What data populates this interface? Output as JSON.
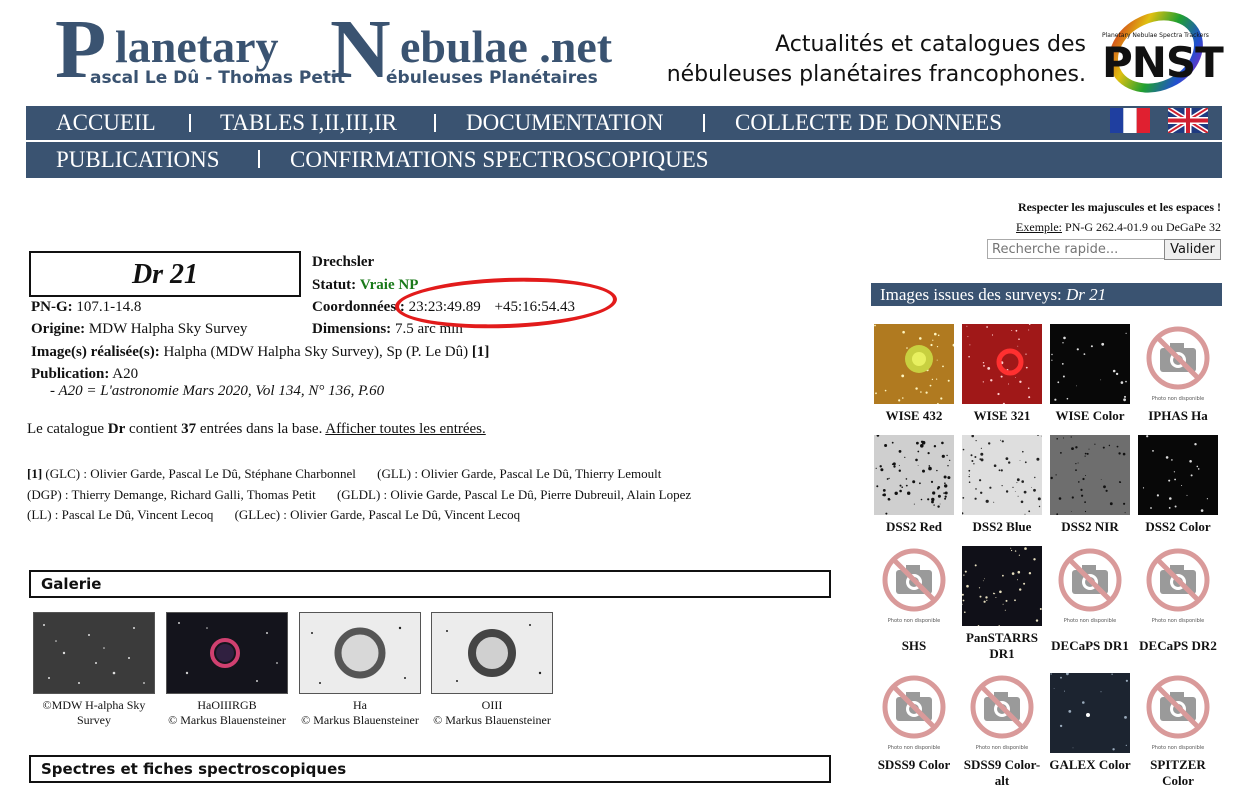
{
  "header": {
    "logo_word1": "lanetary",
    "logo_word2": "ebulae .net",
    "logo_sub1": "ascal Le Dû - Thomas Petit",
    "logo_sub2": "ébuleuses Planétaires",
    "tagline_line1": "Actualités et catalogues des",
    "tagline_line2": "nébuleuses planétaires francophones.",
    "pnst_small": "Planetary Nebulae Spectra Trackers",
    "pnst_big": "PNST"
  },
  "nav": {
    "row1": [
      "ACCUEIL",
      "TABLES I,II,III,IR",
      "DOCUMENTATION",
      "COLLECTE DE DONNEES"
    ],
    "row2": [
      "PUBLICATIONS",
      "CONFIRMATIONS SPECTROSCOPIQUES"
    ]
  },
  "search": {
    "hint": "Respecter les majuscules et les espaces !",
    "example_label": "Exemple:",
    "example_text": "PN-G 262.4-01.9 ou DeGaPe 32",
    "placeholder": "Recherche rapide...",
    "button": "Valider"
  },
  "object": {
    "name": "Dr 21",
    "discoverer": "Drechsler",
    "pn_g_label": "PN-G:",
    "pn_g": "107.1-14.8",
    "origin_label": "Origine:",
    "origin": "MDW Halpha Sky Survey",
    "status_label": "Statut:",
    "status": "Vraie NP",
    "coord_label": "Coordonnées :",
    "ra": "23:23:49.89",
    "dec": "+45:16:54.43",
    "dim_label": "Dimensions:",
    "dim": "7.5 arc min",
    "images_label": "Image(s) réalisée(s):",
    "images": "Halpha (MDW Halpha Sky Survey), Sp (P. Le Dû)",
    "images_ref": "[1]",
    "pub_label": "Publication:",
    "pub": "A20",
    "pub_detail": "- A20 = L'astronomie Mars 2020, Vol 134, N° 136, P.60",
    "colors": {
      "status": "#1a7a1a",
      "highlight": "#e21b1b"
    }
  },
  "catalogue": {
    "prefix": "Le catalogue",
    "name": "Dr",
    "middle": "contient",
    "count": "37",
    "suffix": "entrées dans la base.",
    "link": "Afficher toutes les entrées."
  },
  "credits": {
    "ref": "[1]",
    "line1a": "(GLC) : Olivier Garde, Pascal Le Dû, Stéphane Charbonnel",
    "line1b": "(GLL) : Olivier Garde, Pascal Le Dû, Thierry Lemoult",
    "line2a": "(DGP) : Thierry Demange, Richard Galli, Thomas Petit",
    "line2b": "(GLDL) : Olivie Garde, Pascal Le Dû, Pierre Dubreuil, Alain Lopez",
    "line3a": "(LL) : Pascal Le Dû, Vincent Lecoq",
    "line3b": "(GLLec) : Olivier Garde, Pascal Le Dû, Vincent Lecoq"
  },
  "gallery": {
    "title": "Galerie",
    "items": [
      {
        "cap1": "©MDW H-alpha Sky",
        "cap2": "Survey",
        "icon": "starfield-image"
      },
      {
        "cap1": "HaOIIIRGB",
        "cap2": "© Markus Blauensteiner",
        "icon": "nebula-color-image"
      },
      {
        "cap1": "Ha",
        "cap2": "© Markus Blauensteiner",
        "icon": "nebula-bw-image"
      },
      {
        "cap1": "OIII",
        "cap2": "© Markus Blauensteiner",
        "icon": "nebula-bw-image"
      }
    ]
  },
  "spectra": {
    "title": "Spectres et fiches spectroscopiques"
  },
  "surveys": {
    "title_prefix": "Images issues des surveys:",
    "title_obj": "Dr 21",
    "unavailable_text": "Photo non disponible",
    "items": [
      {
        "label": "WISE 432",
        "kind": "wise432"
      },
      {
        "label": "WISE 321",
        "kind": "wise321"
      },
      {
        "label": "WISE Color",
        "kind": "dark"
      },
      {
        "label": "IPHAS Ha",
        "kind": "na"
      },
      {
        "label": "DSS2 Red",
        "kind": "light"
      },
      {
        "label": "DSS2 Blue",
        "kind": "light2"
      },
      {
        "label": "DSS2 NIR",
        "kind": "grey"
      },
      {
        "label": "DSS2 Color",
        "kind": "dark"
      },
      {
        "label": "SHS",
        "kind": "na"
      },
      {
        "label": "PanSTARRS DR1",
        "kind": "panstarrs"
      },
      {
        "label": "DECaPS DR1",
        "kind": "na"
      },
      {
        "label": "DECaPS DR2",
        "kind": "na"
      },
      {
        "label": "SDSS9 Color",
        "kind": "na"
      },
      {
        "label": "SDSS9 Color-alt",
        "kind": "na"
      },
      {
        "label": "GALEX Color",
        "kind": "galex"
      },
      {
        "label": "SPITZER Color",
        "kind": "na"
      }
    ]
  }
}
